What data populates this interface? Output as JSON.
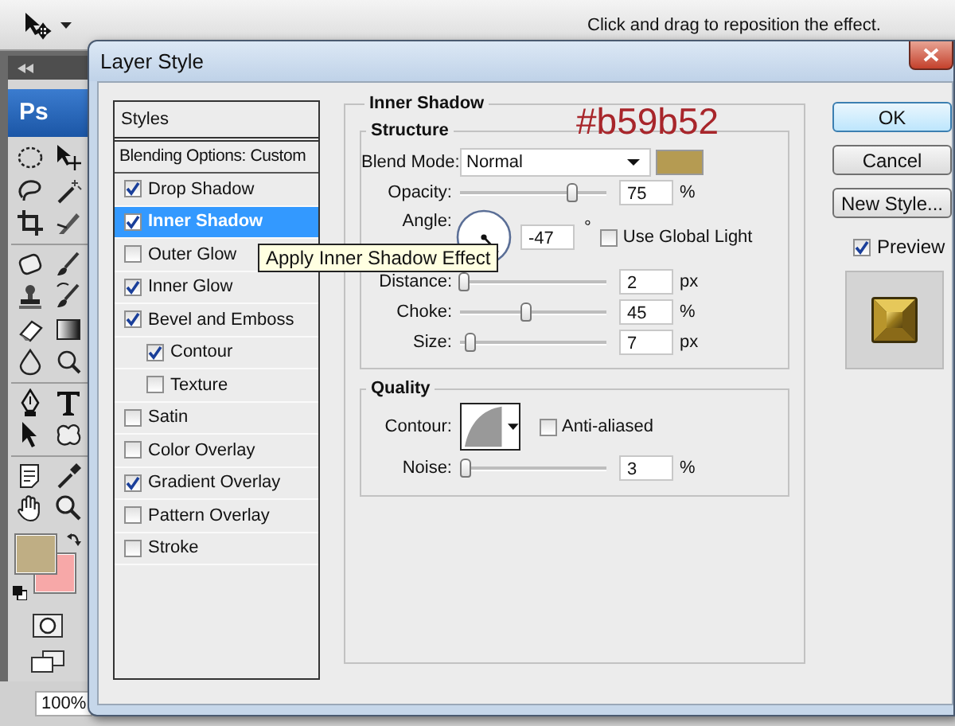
{
  "options_bar": {
    "hint": "Click and drag to reposition the effect."
  },
  "toolbox": {
    "logo": "Ps"
  },
  "status_bar": {
    "zoom": "100%"
  },
  "dialog": {
    "title": "Layer Style",
    "styles_header": "Styles",
    "blending_options": {
      "label": "Blending Options: Custom",
      "selected": false
    },
    "styles": [
      {
        "label": "Drop Shadow",
        "checked": true,
        "selected": false
      },
      {
        "label": "Inner Shadow",
        "checked": true,
        "selected": true
      },
      {
        "label": "Outer Glow",
        "checked": false,
        "selected": false
      },
      {
        "label": "Inner Glow",
        "checked": true,
        "selected": false
      },
      {
        "label": "Bevel and Emboss",
        "checked": true,
        "selected": false,
        "children": [
          {
            "label": "Contour",
            "checked": true,
            "selected": false
          },
          {
            "label": "Texture",
            "checked": false,
            "selected": false
          }
        ]
      },
      {
        "label": "Satin",
        "checked": false,
        "selected": false
      },
      {
        "label": "Color Overlay",
        "checked": false,
        "selected": false
      },
      {
        "label": "Gradient Overlay",
        "checked": true,
        "selected": false
      },
      {
        "label": "Pattern Overlay",
        "checked": false,
        "selected": false
      },
      {
        "label": "Stroke",
        "checked": false,
        "selected": false
      }
    ],
    "tooltip": "Apply Inner Shadow Effect",
    "panel": {
      "title": "Inner Shadow",
      "annotation": "#b59b52",
      "structure": {
        "title": "Structure",
        "blend_mode": {
          "label": "Blend Mode:",
          "value": "Normal",
          "color": "#b59b52"
        },
        "controls": [
          {
            "kind": "slider",
            "label": "Opacity:",
            "level": 0.76,
            "value": "75",
            "unit": "%"
          },
          {
            "kind": "angle",
            "label": "Angle:",
            "value": "-47",
            "unit": "°",
            "global_light": {
              "label": "Use Global Light",
              "checked": false
            }
          },
          {
            "kind": "slider",
            "label": "Distance:",
            "level": 0.02,
            "value": "2",
            "unit": "px"
          },
          {
            "kind": "slider",
            "label": "Choke:",
            "level": 0.45,
            "value": "45",
            "unit": "%"
          },
          {
            "kind": "slider",
            "label": "Size:",
            "level": 0.07,
            "value": "7",
            "unit": "px"
          }
        ]
      },
      "quality": {
        "title": "Quality",
        "contour_label": "Contour:",
        "anti_aliased": {
          "label": "Anti-aliased",
          "checked": false
        },
        "noise": {
          "kind": "slider",
          "label": "Noise:",
          "level": 0.03,
          "value": "3",
          "unit": "%"
        }
      }
    },
    "buttons": [
      {
        "label": "OK",
        "default": true
      },
      {
        "label": "Cancel",
        "default": false
      },
      {
        "label": "New Style...",
        "default": false
      }
    ],
    "preview": {
      "label": "Preview",
      "checked": true
    }
  }
}
